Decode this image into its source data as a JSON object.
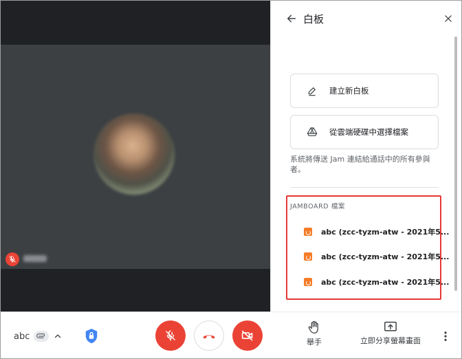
{
  "panel": {
    "title": "白板",
    "options": [
      {
        "label": "建立新白板",
        "icon": "pencil-icon"
      },
      {
        "label": "從雲端硬碟中選擇檔案",
        "icon": "google-drive-icon"
      }
    ],
    "note": "系統將傳送 Jam 連結給通話中的所有參與者。",
    "jamboard_heading": "JAMBOARD 檔案",
    "jamboard_files": [
      {
        "label": "abc (zcc-tyzm-atw - 2021年5..."
      },
      {
        "label": "abc (zcc-tyzm-atw - 2021年5..."
      },
      {
        "label": "abc (zcc-tyzm-atw - 2021年5..."
      }
    ]
  },
  "bottom_bar": {
    "meeting_code": "abc",
    "raise_hand_label": "舉手",
    "present_label": "立即分享螢幕畫面"
  },
  "colors": {
    "danger": "#ea4335",
    "highlight_box": "#e53935",
    "jamboard_orange": "#f57c28",
    "shield_blue": "#4285f4"
  }
}
